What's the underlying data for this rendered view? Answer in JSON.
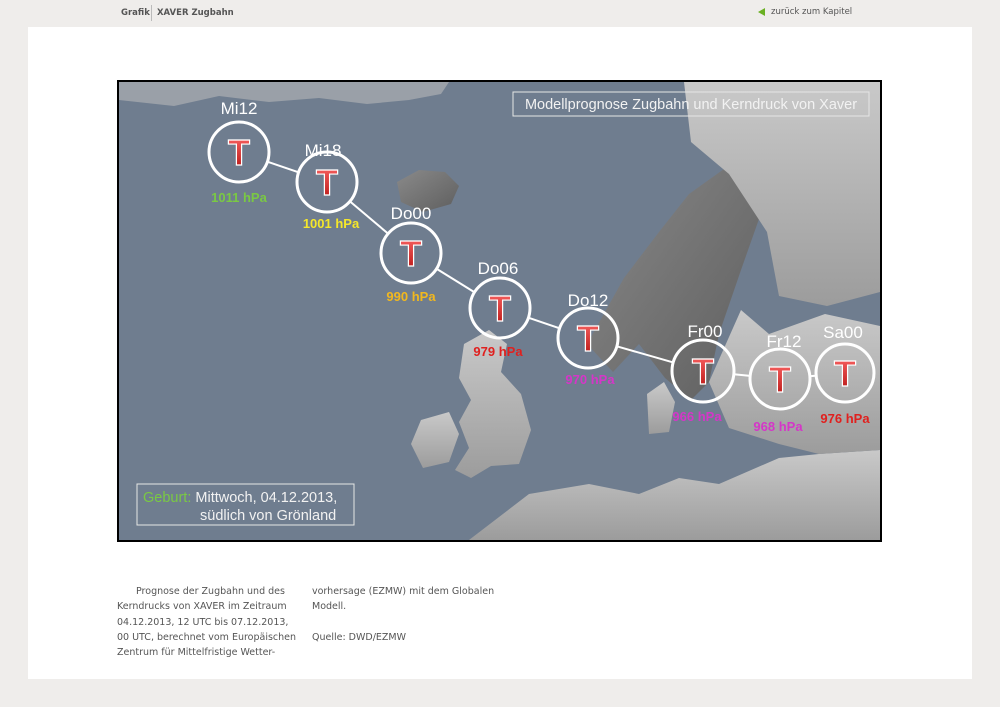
{
  "header": {
    "section": "Grafik",
    "title": "XAVER Zugbahn",
    "back_link": "zurück zum Kapitel",
    "accent_color": "#6ab023"
  },
  "map": {
    "title": "Modellprognose Zugbahn und Kerndruck von Xaver",
    "birth_label": "Geburt:",
    "birth_line1": "Mittwoch, 04.12.2013,",
    "birth_line2": "südlich von Grönland",
    "low_symbol": "T",
    "stations": [
      {
        "time": "Mi12",
        "pressure": "1011 hPa",
        "color": "#7ac943"
      },
      {
        "time": "Mi18",
        "pressure": "1001 hPa",
        "color": "#f5e72a"
      },
      {
        "time": "Do00",
        "pressure": "990 hPa",
        "color": "#f2b81e"
      },
      {
        "time": "Do06",
        "pressure": "979 hPa",
        "color": "#e0201e"
      },
      {
        "time": "Do12",
        "pressure": "970 hPa",
        "color": "#d536c8"
      },
      {
        "time": "Fr00",
        "pressure": "966 hPa",
        "color": "#d536c8"
      },
      {
        "time": "Fr12",
        "pressure": "968 hPa",
        "color": "#d536c8"
      },
      {
        "time": "Sa00",
        "pressure": "976 hPa",
        "color": "#e0201e"
      }
    ]
  },
  "caption": {
    "left": "Prognose der Zugbahn und des Kerndrucks von XAVER im Zeitraum 04.12.2013, 12 UTC bis 07.12.2013, 00 UTC, berechnet vom Europäischen Zentrum für Mittelfristige Wetter-",
    "right": "vorhersage (EZMW) mit dem Globalen Modell.",
    "source": "Quelle: DWD/EZMW"
  }
}
